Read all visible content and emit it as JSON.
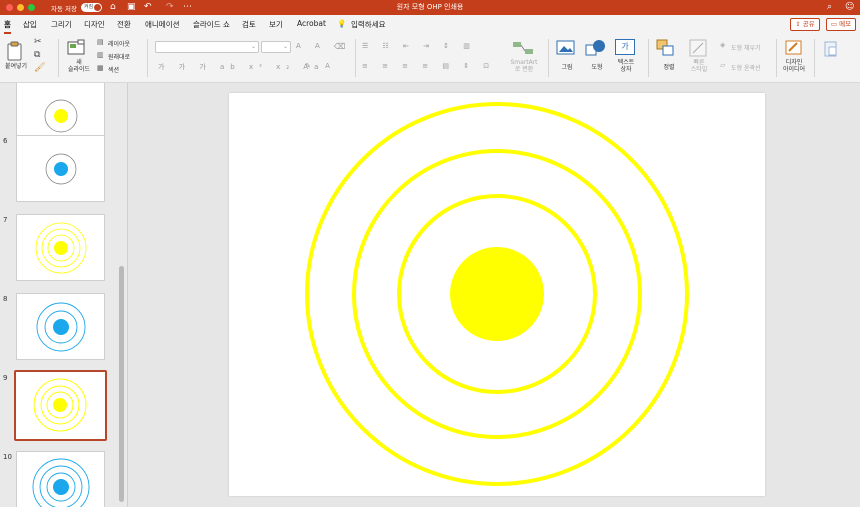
{
  "titlebar": {
    "autosave_label": "자동 저장",
    "autosave_state": "켜짐",
    "document_title": "원자 모형 OHP 인쇄용",
    "icons": [
      "home-icon",
      "save-icon",
      "undo-icon",
      "redo-icon",
      "more-icon",
      "search-icon",
      "profile-icon"
    ]
  },
  "menu": {
    "tabs": [
      "홈",
      "삽입",
      "그리기",
      "디자인",
      "전환",
      "애니메이션",
      "슬라이드 쇼",
      "검토",
      "보기",
      "Acrobat"
    ],
    "active_tab": "홈",
    "tell_me": "입력하세요",
    "share_label": "공유",
    "comments_label": "메모"
  },
  "ribbon": {
    "paste_label": "붙여넣기",
    "new_slide_label": "새\n슬라이드",
    "layout_label": "레이아웃",
    "reset_label": "원래대로",
    "section_label": "섹션",
    "smartart_label": "SmartArt\n로 변환",
    "picture_label": "그림",
    "shape_label": "도형",
    "textbox_label": "텍스트\n상자",
    "textbox_glyph": "가",
    "arrange_label": "정렬",
    "quick_styles_label": "빠른\n스타일",
    "shape_fill_label": "도형 채우기",
    "shape_outline_label": "도형 윤곽선",
    "designer_label": "디자인\n아이디어"
  },
  "thumbnails": [
    {
      "number": "",
      "style": "yellow-nucleus-one-ring"
    },
    {
      "number": "6",
      "style": "blue-nucleus-one-ring"
    },
    {
      "number": "7",
      "style": "yellow-nucleus-three-rings"
    },
    {
      "number": "8",
      "style": "blue-nucleus-two-rings"
    },
    {
      "number": "9",
      "style": "yellow-nucleus-three-rings",
      "selected": true
    },
    {
      "number": "10",
      "style": "blue-nucleus-three-rings"
    }
  ],
  "colors": {
    "accent": "#c43e1c",
    "atom_yellow": "#ffff00",
    "atom_blue": "#1aa7ec"
  }
}
